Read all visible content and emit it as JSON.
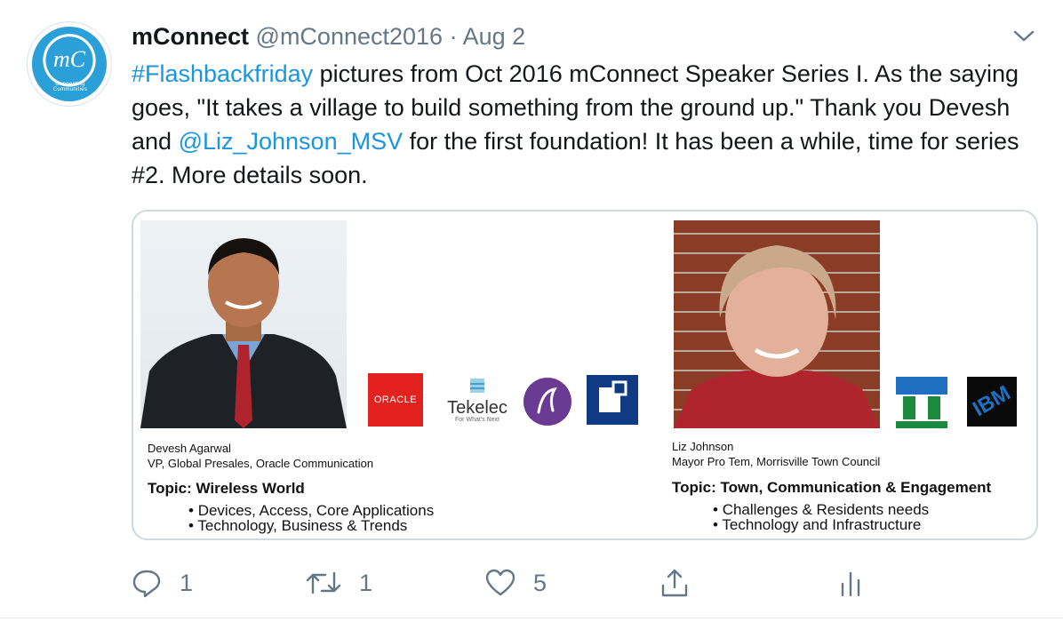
{
  "tweet": {
    "author_name": "mConnect",
    "author_handle": "@mConnect2016",
    "separator": "·",
    "date": "Aug 2",
    "avatar_initials": "mC",
    "avatar_tagline": "Connecting Communities",
    "text_part1": "#Flashbackfriday",
    "text_part2": " pictures from Oct 2016 mConnect Speaker Series I. As the saying goes, \"It takes a village to build something from the ground up.\" Thank you Devesh and ",
    "text_part3": "@Liz_Johnson_MSV",
    "text_part4": " for the first foundation! It has been a while, time for series #2. More details soon."
  },
  "card": {
    "speaker1": {
      "name": "Devesh Agarwal",
      "title": "VP, Global Presales, Oracle Communication",
      "topic": "Topic: Wireless World",
      "bullets": [
        "Devices, Access, Core Applications",
        "Technology, Business & Trends"
      ],
      "logos": [
        "ORACLE",
        "Tekelec",
        "For What's Next"
      ]
    },
    "speaker2": {
      "name": "Liz Johnson",
      "title": "Mayor Pro Tem, Morrisville Town Council",
      "topic": "Topic: Town, Communication & Engagement",
      "bullets": [
        "Challenges & Residents needs",
        "Technology and Infrastructure"
      ],
      "logos": [
        "IBM"
      ]
    }
  },
  "actions": {
    "reply_count": "1",
    "retweet_count": "1",
    "like_count": "5"
  },
  "colors": {
    "link": "#1b95e0",
    "muted": "#657786",
    "oracle_red": "#e3211f",
    "ibm_blue": "#1f70c1"
  }
}
